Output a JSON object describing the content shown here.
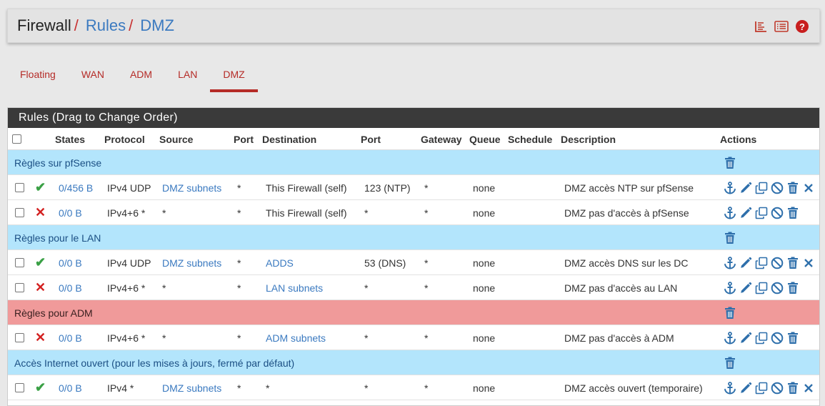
{
  "breadcrumb": {
    "root": "Firewall",
    "sep": "/",
    "rules": "Rules",
    "current": "DMZ"
  },
  "header_icons": [
    "chart-icon",
    "list-icon",
    "help-icon"
  ],
  "help_label": "?",
  "tabs": [
    {
      "label": "Floating",
      "active": false
    },
    {
      "label": "WAN",
      "active": false
    },
    {
      "label": "ADM",
      "active": false
    },
    {
      "label": "LAN",
      "active": false
    },
    {
      "label": "DMZ",
      "active": true
    }
  ],
  "panel": {
    "title": "Rules (Drag to Change Order)",
    "columns": {
      "states": "States",
      "protocol": "Protocol",
      "source": "Source",
      "port": "Port",
      "destination": "Destination",
      "dport": "Port",
      "gateway": "Gateway",
      "queue": "Queue",
      "schedule": "Schedule",
      "description": "Description",
      "actions": "Actions"
    }
  },
  "rows": [
    {
      "type": "separator",
      "color": "blue",
      "label": "Règles sur pfSense"
    },
    {
      "type": "rule",
      "status": "pass",
      "status_glyph": "✔",
      "states": "0/456 B",
      "protocol": "IPv4 UDP",
      "source": "DMZ subnets",
      "source_link": true,
      "port": "*",
      "destination": "This Firewall (self)",
      "dest_link": false,
      "dport": "123 (NTP)",
      "gateway": "*",
      "queue": "none",
      "schedule": "",
      "description": "DMZ accès NTP sur pfSense",
      "deletable": true
    },
    {
      "type": "rule",
      "status": "block",
      "status_glyph": "✕",
      "states": "0/0 B",
      "protocol": "IPv4+6 *",
      "source": "*",
      "source_link": false,
      "port": "*",
      "destination": "This Firewall (self)",
      "dest_link": false,
      "dport": "*",
      "gateway": "*",
      "queue": "none",
      "schedule": "",
      "description": "DMZ pas d'accès à pfSense",
      "deletable": false
    },
    {
      "type": "separator",
      "color": "blue",
      "label": "Règles pour le LAN"
    },
    {
      "type": "rule",
      "status": "pass",
      "status_glyph": "✔",
      "states": "0/0 B",
      "protocol": "IPv4 UDP",
      "source": "DMZ subnets",
      "source_link": true,
      "port": "*",
      "destination": "ADDS",
      "dest_link": true,
      "dport": "53 (DNS)",
      "gateway": "*",
      "queue": "none",
      "schedule": "",
      "description": "DMZ accès DNS sur les DC",
      "deletable": true
    },
    {
      "type": "rule",
      "status": "block",
      "status_glyph": "✕",
      "states": "0/0 B",
      "protocol": "IPv4+6 *",
      "source": "*",
      "source_link": false,
      "port": "*",
      "destination": "LAN subnets",
      "dest_link": true,
      "dport": "*",
      "gateway": "*",
      "queue": "none",
      "schedule": "",
      "description": "DMZ pas d'accès au LAN",
      "deletable": false
    },
    {
      "type": "separator",
      "color": "red",
      "label": "Règles pour ADM"
    },
    {
      "type": "rule",
      "status": "block",
      "status_glyph": "✕",
      "states": "0/0 B",
      "protocol": "IPv4+6 *",
      "source": "*",
      "source_link": false,
      "port": "*",
      "destination": "ADM subnets",
      "dest_link": true,
      "dport": "*",
      "gateway": "*",
      "queue": "none",
      "schedule": "",
      "description": "DMZ pas d'accès à ADM",
      "deletable": false
    },
    {
      "type": "separator",
      "color": "blue",
      "label": "Accès Internet ouvert (pour les mises à jours, fermé par défaut)"
    },
    {
      "type": "rule",
      "status": "pass",
      "status_glyph": "✔",
      "states": "0/0 B",
      "protocol": "IPv4 *",
      "source": "DMZ subnets",
      "source_link": true,
      "port": "*",
      "destination": "*",
      "dest_link": false,
      "dport": "*",
      "gateway": "*",
      "queue": "none",
      "schedule": "",
      "description": "DMZ accès ouvert (temporaire)",
      "deletable": true
    }
  ],
  "colors": {
    "accent_red": "#b52b27",
    "link_blue": "#3b7ac0",
    "separator_blue": "#b3e5fc",
    "separator_red": "#f09a9a",
    "panel_heading": "#3a3a3a"
  }
}
